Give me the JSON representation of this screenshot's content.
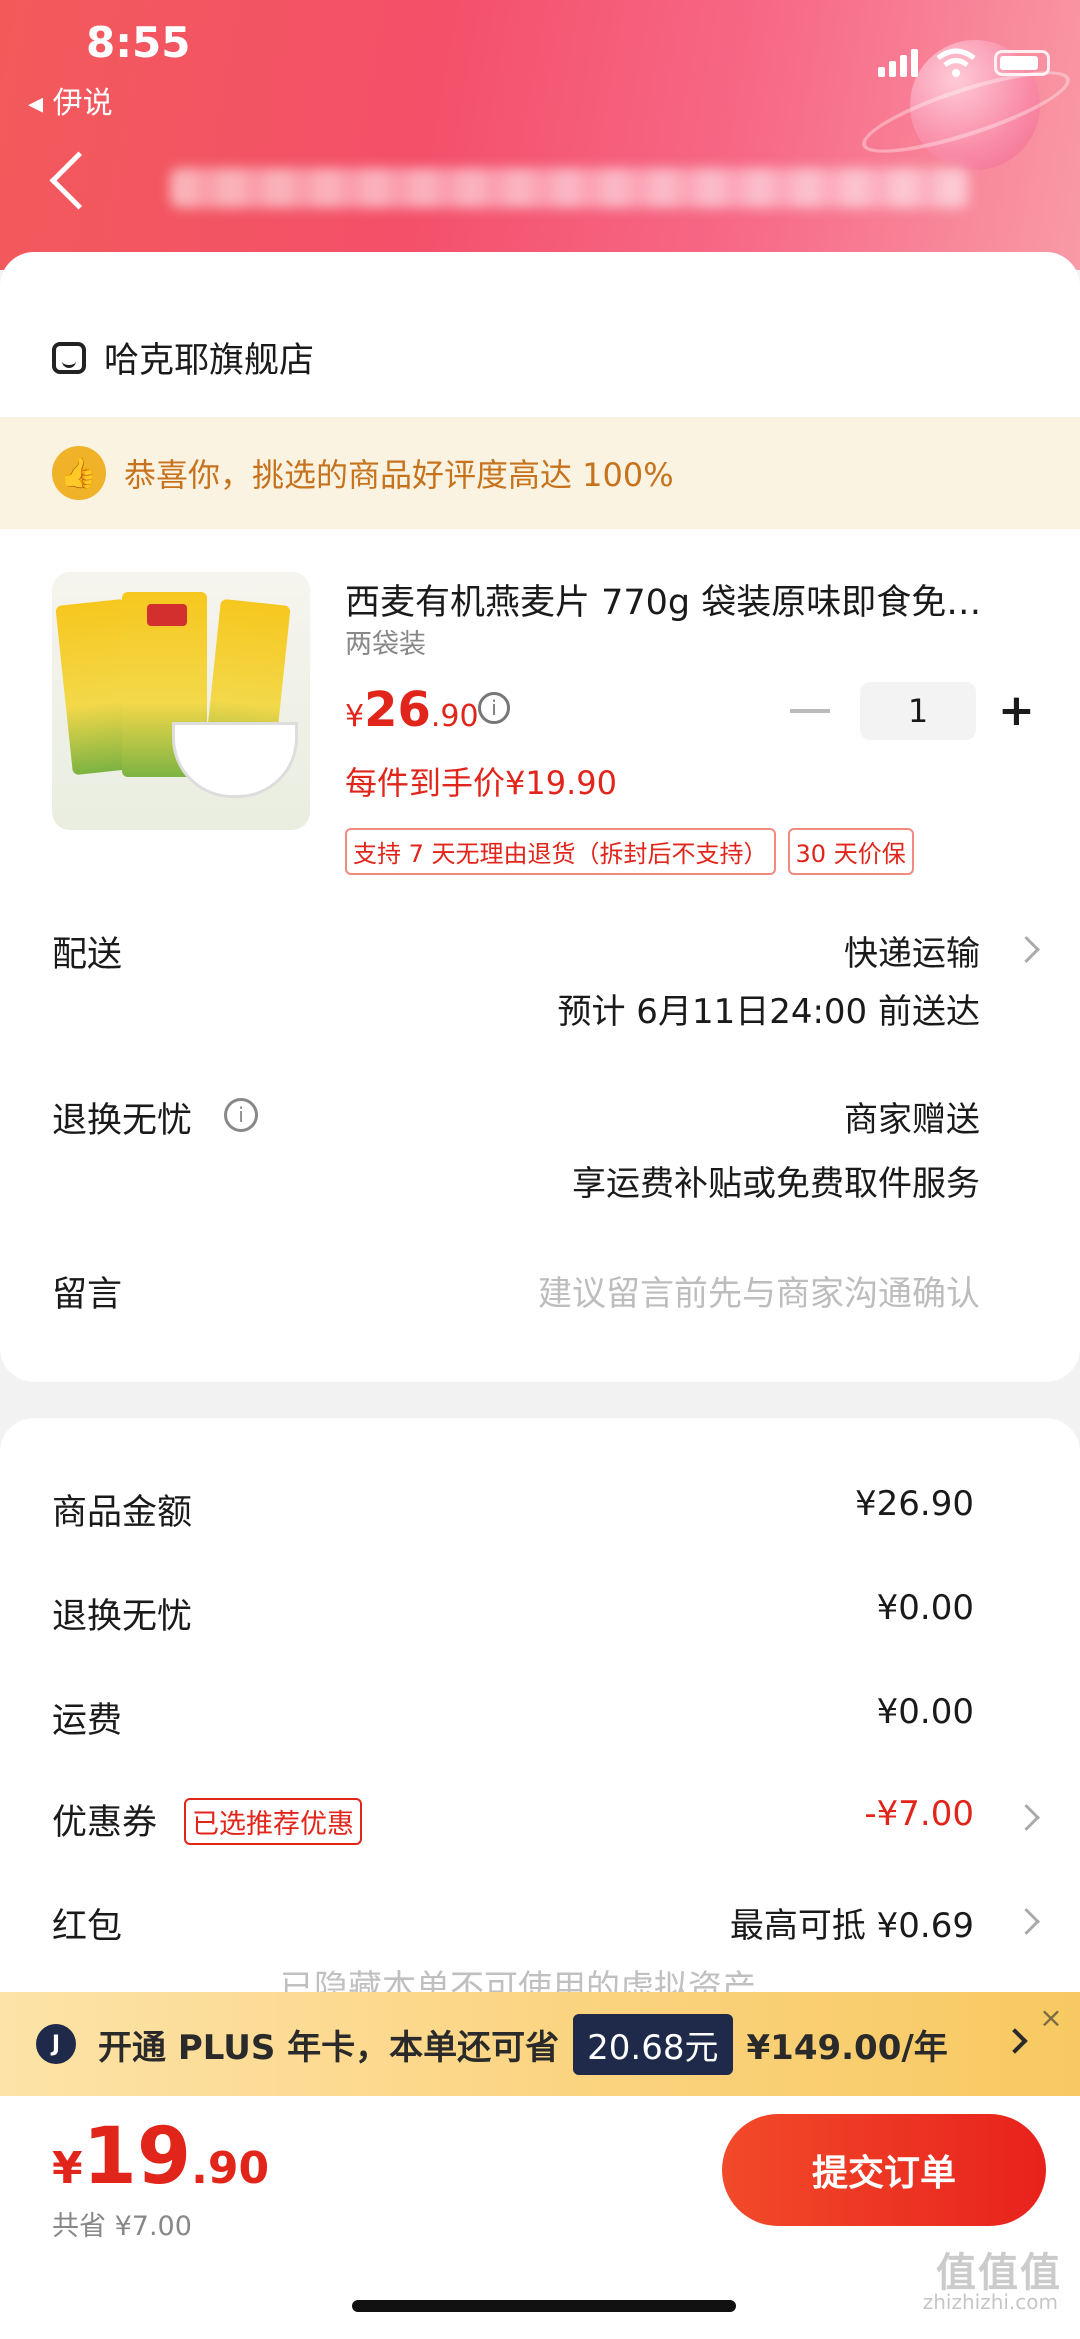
{
  "status": {
    "time": "8:55",
    "back_app": "伊说"
  },
  "shop": {
    "name": "哈克耶旗舰店"
  },
  "praise": {
    "text": "恭喜你，挑选的商品好评度高达 100%"
  },
  "product": {
    "title": "西麦有机燕麦片 770g 袋装原味即食免…",
    "spec": "两袋装",
    "price": {
      "yen": "¥",
      "int": "26",
      "dec": ".90"
    },
    "quantity": "1",
    "each_price": "每件到手价¥19.90",
    "tags": [
      "支持 7 天无理由退货（拆封后不支持）",
      "30 天价保"
    ]
  },
  "delivery": {
    "label": "配送",
    "method": "快递运输",
    "eta": "预计 6月11日24:00 前送达"
  },
  "return": {
    "label": "退换无忧",
    "value": "商家赠送",
    "sub": "享运费补贴或免费取件服务"
  },
  "note": {
    "label": "留言",
    "placeholder": "建议留言前先与商家沟通确认"
  },
  "summary": {
    "goods_label": "商品金额",
    "goods_value": "¥26.90",
    "return_label": "退换无忧",
    "return_value": "¥0.00",
    "shipping_label": "运费",
    "shipping_value": "¥0.00",
    "coupon_label": "优惠券",
    "coupon_tag": "已选推荐优惠",
    "coupon_value": "-¥7.00",
    "redpack_label": "红包",
    "redpack_value": "最高可抵 ¥0.69",
    "hidden_note": "已隐藏本单不可使用的虚拟资产"
  },
  "plus": {
    "logo": "J",
    "text": "开通 PLUS 年卡，本单还可省",
    "save": "20.68元",
    "price": "¥149.00/年",
    "close": "×"
  },
  "footer": {
    "yen": "¥",
    "int": "19",
    "dec": ".90",
    "saved": "共省 ¥7.00",
    "submit": "提交订单"
  },
  "watermark": {
    "main": "值值值",
    "sub": "zhizhizhi.com"
  },
  "colors": {
    "accent": "#e1251b",
    "header_start": "#f25a5a",
    "plus_bg": "#fbd27c"
  }
}
